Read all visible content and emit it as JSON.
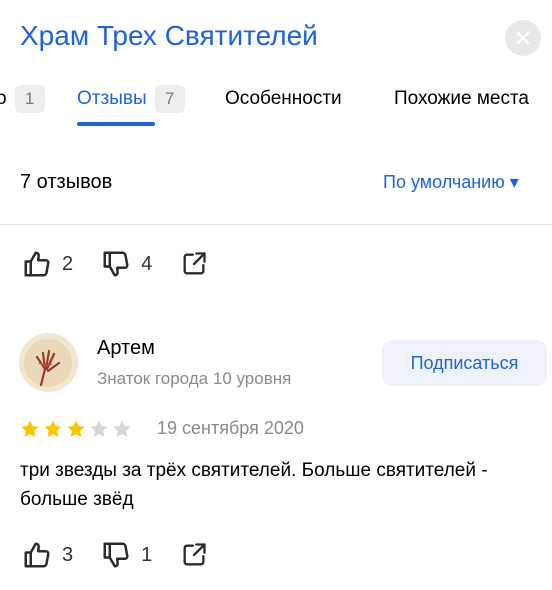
{
  "place": {
    "title": "Храм Трех Святителей"
  },
  "tabs": [
    {
      "label": "о",
      "count": "1",
      "active": false
    },
    {
      "label": "Отзывы",
      "count": "7",
      "active": true
    },
    {
      "label": "Особенности"
    },
    {
      "label": "Похожие места"
    }
  ],
  "reviews_header": {
    "count_label": "7 отзывов",
    "sort_label": "По умолчанию ▾"
  },
  "prev_review_actions": {
    "likes": "2",
    "dislikes": "4"
  },
  "review": {
    "author": "Артем",
    "author_level": "Знаток города 10 уровня",
    "subscribe_label": "Подписаться",
    "rating": 3,
    "rating_max": 5,
    "date": "19 сентября 2020",
    "text": "три звезды за трёх святителей. Больше святителей - больше звёд",
    "likes": "3",
    "dislikes": "1"
  },
  "colors": {
    "accent": "#1e63d8",
    "star_filled": "#fcc500",
    "star_empty": "#d6d6d6"
  },
  "icons": [
    "close-icon",
    "thumbs-up-icon",
    "thumbs-down-icon",
    "share-icon",
    "star-icon"
  ]
}
